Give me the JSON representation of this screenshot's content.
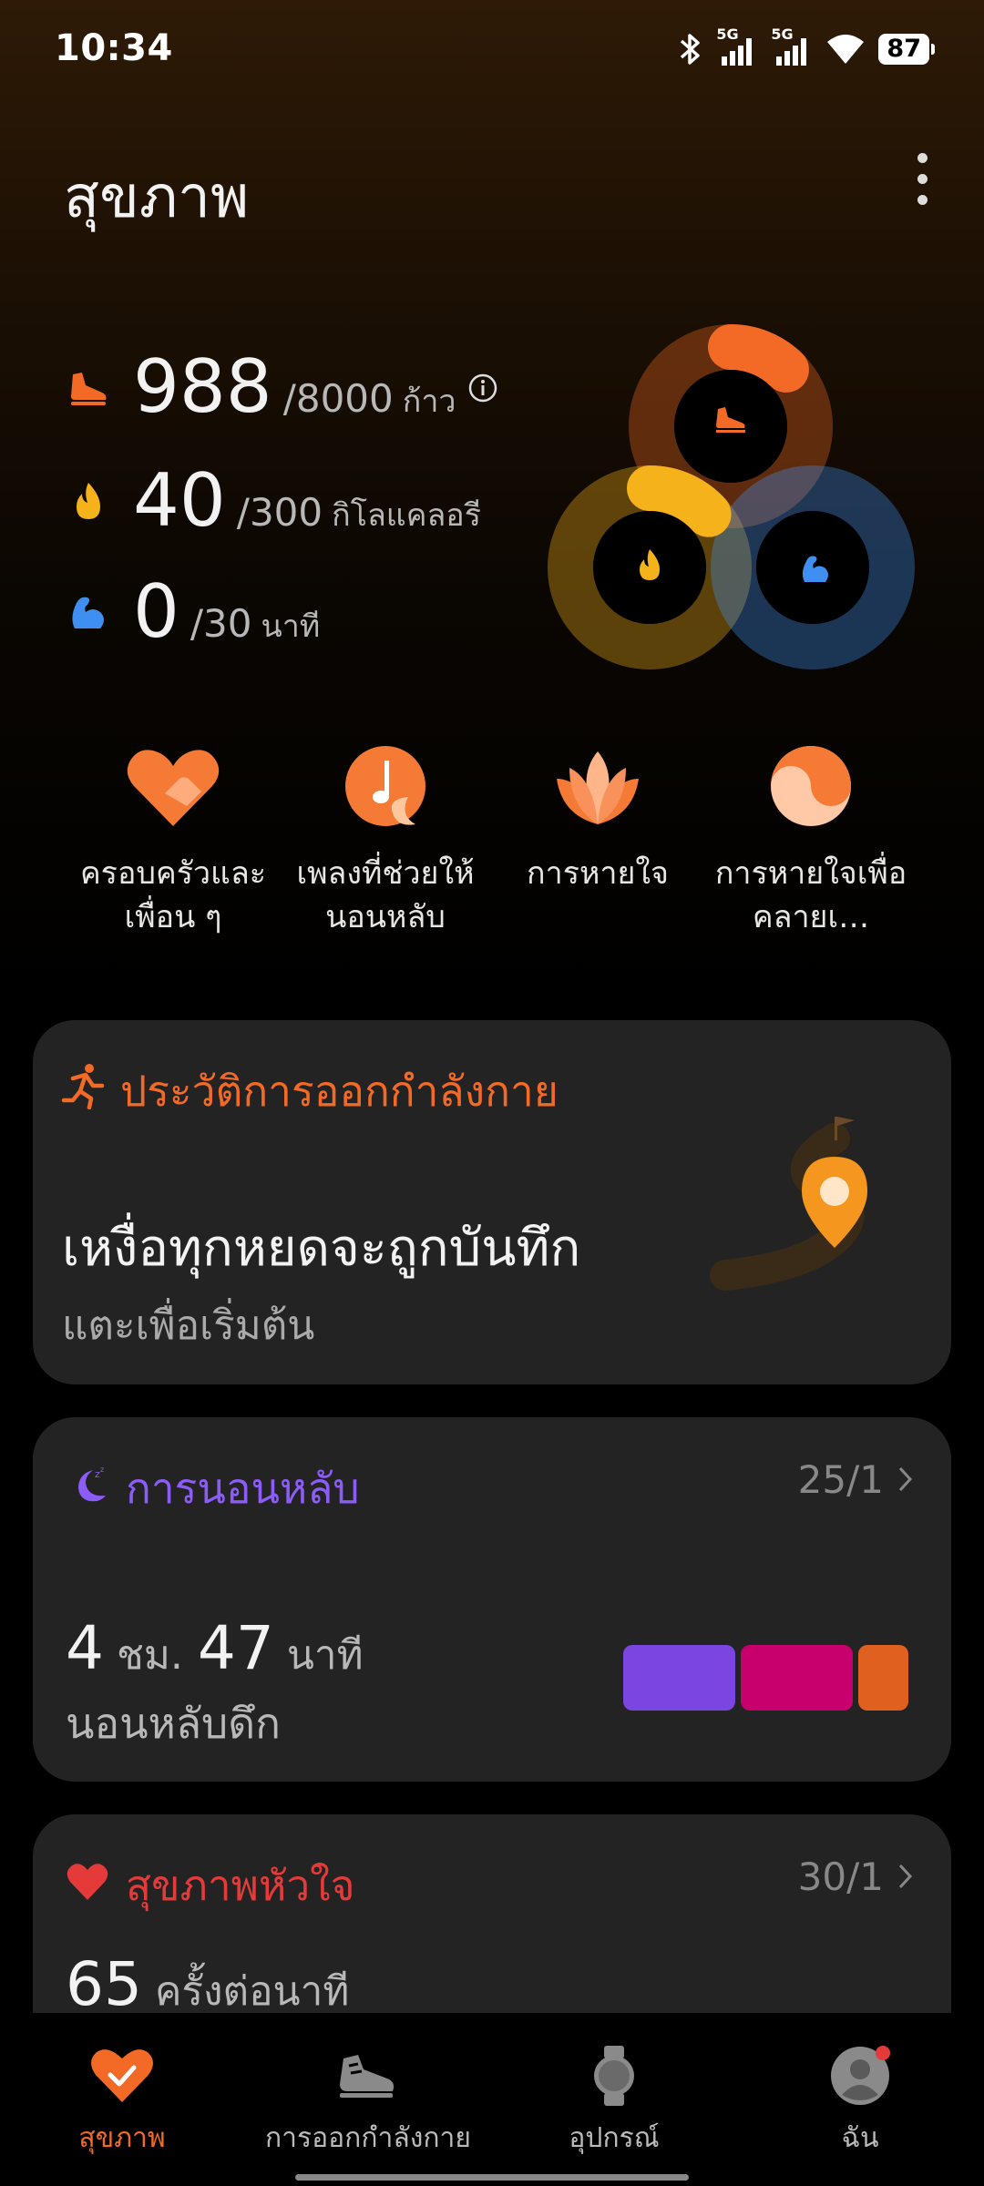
{
  "status_bar": {
    "time": "10:34",
    "battery": "87",
    "network_1": "5G",
    "network_2": "5G",
    "icons": [
      "bluetooth-icon",
      "signal-icon",
      "signal-icon",
      "wifi-icon",
      "battery-icon"
    ]
  },
  "header": {
    "title": "สุขภาพ",
    "menu_icon": "more-vertical-icon"
  },
  "activity": {
    "steps": {
      "value": "988",
      "goal": "/8000",
      "unit": "ก้าว",
      "icon": "shoe-icon",
      "color": "#f26a25",
      "progress": 0.1235
    },
    "calories": {
      "value": "40",
      "goal": "/300",
      "unit": "กิโลแคลอรี",
      "icon": "flame-icon",
      "color": "#f5b21a",
      "progress": 0.133
    },
    "active": {
      "value": "0",
      "goal": "/30",
      "unit": "นาที",
      "icon": "arm-icon",
      "color": "#3f8ef2",
      "progress": 0
    }
  },
  "shortcuts": [
    {
      "label": "ครอบครัวและเพื่อน ๆ",
      "icon": "family-heart-icon"
    },
    {
      "label": "เพลงที่ช่วยให้นอนหลับ",
      "icon": "sleep-music-icon"
    },
    {
      "label": "การหายใจ",
      "icon": "lotus-icon"
    },
    {
      "label": "การหายใจเพื่อคลายเ…",
      "icon": "yin-yang-icon"
    }
  ],
  "exercise_card": {
    "title": "ประวัติการออกกำลังกาย",
    "headline": "เหงื่อทุกหยดจะถูกบันทึก",
    "subtitle": "แตะเพื่อเริ่มต้น",
    "title_color": "#f26a25",
    "icon": "running-icon",
    "illustration": "map-pin-icon"
  },
  "sleep_card": {
    "title": "การนอนหลับ",
    "date": "25/1",
    "hours": "4",
    "hours_unit": "ชม.",
    "minutes": "47",
    "minutes_unit": "นาที",
    "label": "นอนหลับดึก",
    "title_color": "#8b5cf6",
    "icon": "moon-icon",
    "segments": [
      {
        "color": "#7a45e0",
        "share": 0.38
      },
      {
        "color": "#c7006d",
        "share": 0.38
      },
      {
        "color": "#e0601f",
        "share": 0.17
      }
    ]
  },
  "heart_card": {
    "title": "สุขภาพหัวใจ",
    "date": "30/1",
    "value": "65",
    "unit": "ครั้งต่อนาที",
    "title_color": "#e53a3a",
    "icon": "heart-icon"
  },
  "bottom_nav": [
    {
      "label": "สุขภาพ",
      "icon": "health-heart-icon",
      "active": true
    },
    {
      "label": "การออกกำลังกาย",
      "icon": "sneaker-icon",
      "active": false
    },
    {
      "label": "อุปกรณ์",
      "icon": "watch-icon",
      "active": false
    },
    {
      "label": "ฉัน",
      "icon": "profile-icon",
      "active": false
    }
  ],
  "colors": {
    "accent": "#f26a25",
    "card_bg": "#232323"
  }
}
